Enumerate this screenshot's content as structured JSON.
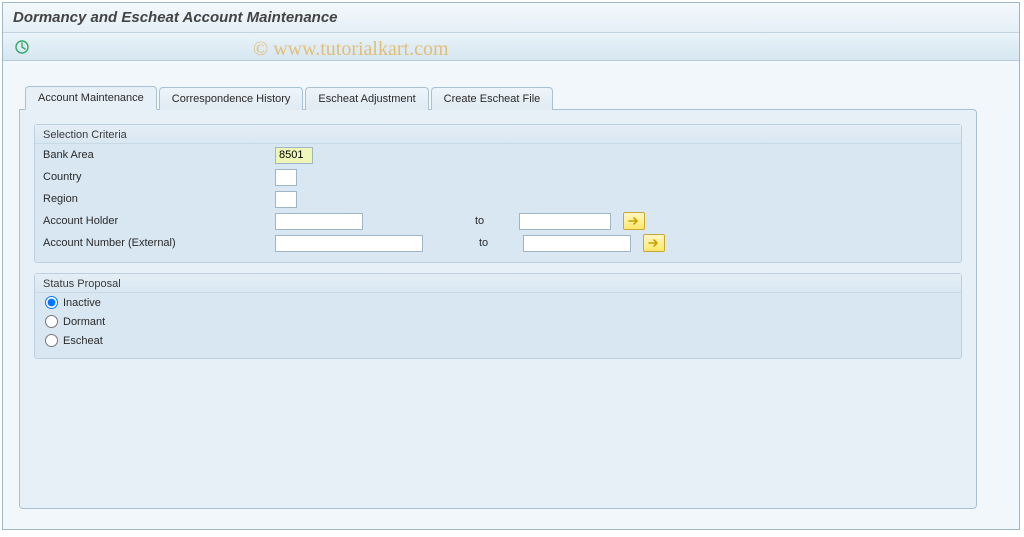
{
  "title": "Dormancy and Escheat Account Maintenance",
  "watermark": "© www.tutorialkart.com",
  "tabs": [
    {
      "label": "Account Maintenance",
      "active": true
    },
    {
      "label": "Correspondence History",
      "active": false
    },
    {
      "label": "Escheat Adjustment",
      "active": false
    },
    {
      "label": "Create Escheat File",
      "active": false
    }
  ],
  "selection_criteria": {
    "title": "Selection Criteria",
    "bank_area": {
      "label": "Bank Area",
      "value": "8501"
    },
    "country": {
      "label": "Country",
      "value": ""
    },
    "region": {
      "label": "Region",
      "value": ""
    },
    "account_holder": {
      "label": "Account Holder",
      "from": "",
      "to_label": "to",
      "to": ""
    },
    "account_number": {
      "label": "Account Number (External)",
      "from": "",
      "to_label": "to",
      "to": ""
    }
  },
  "status_proposal": {
    "title": "Status Proposal",
    "options": [
      {
        "label": "Inactive",
        "selected": true
      },
      {
        "label": "Dormant",
        "selected": false
      },
      {
        "label": "Escheat",
        "selected": false
      }
    ]
  }
}
